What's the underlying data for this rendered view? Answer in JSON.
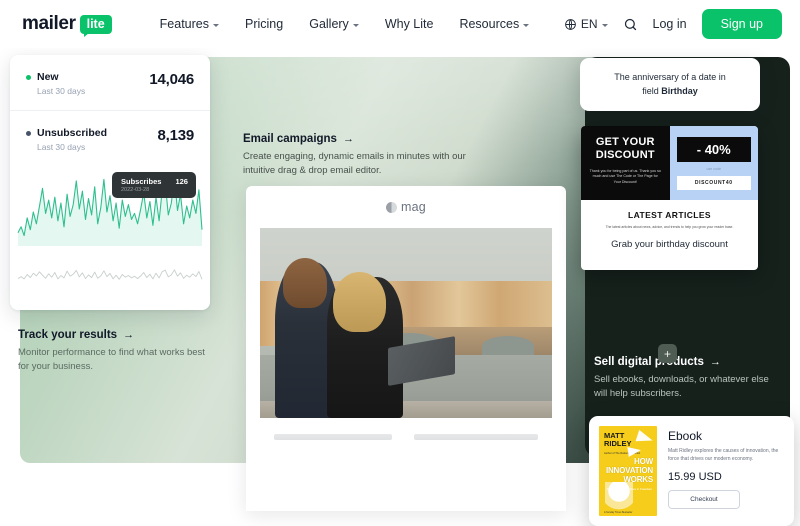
{
  "nav": {
    "logo_primary": "mailer",
    "logo_badge": "lite",
    "links": [
      {
        "label": "Features",
        "has_caret": true
      },
      {
        "label": "Pricing",
        "has_caret": false
      },
      {
        "label": "Gallery",
        "has_caret": true
      },
      {
        "label": "Why Lite",
        "has_caret": false
      },
      {
        "label": "Resources",
        "has_caret": true
      }
    ],
    "language": "EN",
    "globe_icon": "globe-icon",
    "search_icon": "search-icon",
    "login_label": "Log in",
    "signup_label": "Sign up",
    "accent_color": "#09C269"
  },
  "stats_card": {
    "rows": [
      {
        "name": "New",
        "sub": "Last 30 days",
        "value": "14,046",
        "dot_color": "#09C269"
      },
      {
        "name": "Unsubscribed",
        "sub": "Last 30 days",
        "value": "8,139",
        "dot_color": "#475467"
      }
    ],
    "tooltip": {
      "label": "Subscribes",
      "value": "126",
      "date": "2022-03-28"
    }
  },
  "chart_data": {
    "type": "area",
    "title": "Subscribes",
    "xlabel": "",
    "ylabel": "",
    "grid": false,
    "legend_position": "none",
    "series": [
      {
        "name": "Subscribes",
        "color": "#2FBF8F",
        "values": [
          18,
          26,
          14,
          38,
          22,
          46,
          30,
          54,
          78,
          44,
          62,
          38,
          66,
          34,
          58,
          26,
          70,
          40,
          56,
          88,
          50,
          74,
          36,
          64,
          42,
          80,
          30,
          52,
          90,
          46,
          68,
          34,
          58,
          24,
          62,
          40,
          56,
          36,
          44,
          30,
          50,
          72,
          38,
          60,
          28,
          66,
          34,
          74,
          86,
          42,
          58,
          92,
          48,
          70,
          30,
          54,
          38,
          62,
          44,
          76,
          22
        ]
      },
      {
        "name": "Unsubscribes",
        "color": "#C8CFCB",
        "values": [
          10,
          16,
          9,
          22,
          13,
          26,
          18,
          30,
          20,
          11,
          24,
          14,
          28,
          9,
          19,
          12,
          32,
          17,
          23,
          34,
          15,
          27,
          10,
          21,
          13,
          29,
          11,
          18,
          33,
          16,
          25,
          9,
          20,
          8,
          22,
          14,
          19,
          12,
          17,
          10,
          18,
          28,
          13,
          23,
          9,
          26,
          12,
          30,
          35,
          15,
          21,
          36,
          17,
          27,
          11,
          20,
          14,
          24,
          16,
          31,
          8
        ]
      }
    ],
    "ylim": [
      0,
      100
    ]
  },
  "track_block": {
    "title": "Track your results",
    "arrow": "→",
    "body": "Monitor performance to find what works best for your business."
  },
  "email_block": {
    "title": "Email campaigns",
    "arrow": "→",
    "body": "Create engaging, dynamic emails in minutes with our intuitive drag & drop email editor."
  },
  "mail_preview": {
    "brand": "mag",
    "photo_alt": "two women with a laptop by a river bridge"
  },
  "birthday_card": {
    "line1": "The anniversary of a date in",
    "line2_prefix": "field ",
    "line2_bold": "Birthday"
  },
  "promo_card": {
    "heading_line1": "GET YOUR",
    "heading_line2": "DISCOUNT",
    "subtext": "Thank you for being part of us. Thank you so much and use The Code or The Page for Your Discount!",
    "badge": "- 40%",
    "code_caption": "use code",
    "code": "DISCOUNT40",
    "articles_heading": "LATEST ARTICLES",
    "articles_sub": "The latest articles about news, advice, and trends to help you grow your reader base.",
    "article_title": "Grab your birthday discount"
  },
  "sell_block": {
    "plus_icon": "plus-icon",
    "title": "Sell digital products",
    "arrow": "→",
    "body": "Sell ebooks, downloads, or whatever else will help subscribers."
  },
  "ebook_card": {
    "cover": {
      "author_line1": "MATT",
      "author_line2": "RIDLEY",
      "tagline": "Author of The Rational Optimist",
      "title_line1": "HOW",
      "title_line2": "INNOVATION",
      "title_line3": "WORKS",
      "subtitle": "And Why It Flourishes in Freedom",
      "footer": "A Sunday Times Bestseller",
      "bg_color": "#F5CD1A"
    },
    "title": "Ebook",
    "description": "Matt Ridley explores the causes of innovation, the force that drives our modern economy.",
    "price": "15.99 USD",
    "button_label": "Checkout"
  }
}
